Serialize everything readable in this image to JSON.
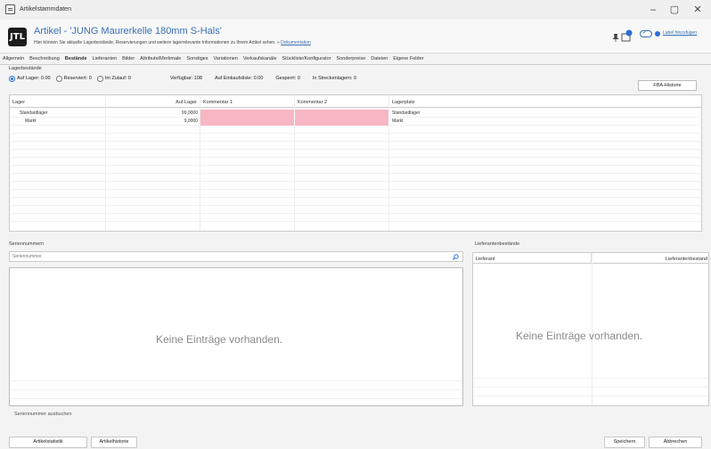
{
  "window": {
    "title": "Artikelstammdaten",
    "min": "–",
    "max": "▢",
    "close": "✕"
  },
  "header": {
    "logo": "JTL",
    "title": "Artikel - 'JUNG Maurerkelle 180mm S-Hals'",
    "subtitle": "Hier können Sie aktuelle Lagerbestände, Reservierungen und weitere lagerrelevante Informationen zu Ihrem Artikel sehen.",
    "doc_link": "Dokumentation",
    "label_link": "Label hinzufügen"
  },
  "tabs": [
    "Allgemein",
    "Beschreibung",
    "Bestände",
    "Lieferanten",
    "Bilder",
    "Attribute/Merkmale",
    "Sonstiges",
    "Variationen",
    "Verkaufskanäle",
    "Stückliste/Konfigurator",
    "Sonderpreise",
    "Dateien",
    "Eigene Felder"
  ],
  "active_tab": "Bestände",
  "lagerbestaende": {
    "title": "Lagerbestände",
    "radios": [
      {
        "label": "Auf Lager: 0.00",
        "checked": true
      },
      {
        "label": "Reserviert: 0",
        "checked": false
      },
      {
        "label": "Im Zulauf: 0",
        "checked": false
      }
    ],
    "stats": [
      "Verfügbar: 108",
      "Auf Einkaufsliste: 0.00",
      "Gesperrt: 0",
      "In Streckenlagern: 0"
    ],
    "fba_button": "FBA-Historie"
  },
  "stock_table": {
    "headers": [
      "Lager",
      "Auf Lager",
      "Kommentar 1",
      "Kommentar 2",
      "Lagerplatz"
    ],
    "rows": [
      {
        "lager": "Standardlager",
        "auf_lager": "99,0000",
        "kommentar1": "",
        "kommentar2": "",
        "lagerplatz": "Standardlager"
      },
      {
        "lager": "Markt",
        "auf_lager": "9,0000",
        "kommentar1": "",
        "kommentar2": "",
        "lagerplatz": "Markt"
      }
    ]
  },
  "seriennummern": {
    "title": "Seriennummern",
    "search_placeholder": "Seriennummer",
    "empty": "Keine Einträge vorhanden.",
    "footer": "Seriennummer ausbuchen"
  },
  "lieferantenbestaende": {
    "title": "Lieferantenbestände",
    "headers": [
      "Lieferant",
      "Lieferantenbestand"
    ],
    "empty": "Keine Einträge vorhanden."
  },
  "buttons": {
    "statistik": "Artikelstatistik",
    "historie": "Artikelhistorie",
    "speichern": "Speichern",
    "abbrechen": "Abbrechen"
  },
  "colors": {
    "accent": "#3a6fb5",
    "empty_cell": "#f7b6c3"
  },
  "icons": {
    "window": "app-window-icon",
    "pin": "pin-icon",
    "notification": "notification-icon",
    "search": "search-icon"
  }
}
